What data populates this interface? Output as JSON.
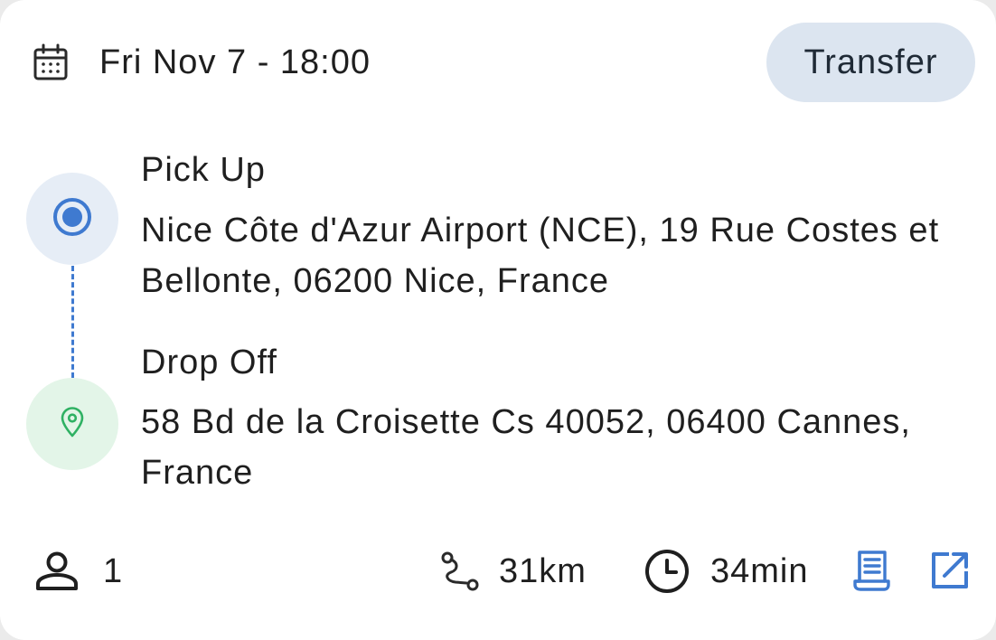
{
  "header": {
    "date_icon": "calendar-icon",
    "datetime": "Fri Nov 7 - 18:00",
    "type_badge": "Transfer"
  },
  "route": {
    "pickup": {
      "icon": "pickup-target-icon",
      "label": "Pick Up",
      "address": "Nice Côte d'Azur Airport (NCE), 19 Rue Costes et Bellonte, 06200 Nice, France",
      "accent_color": "#3f7ad0"
    },
    "dropoff": {
      "icon": "location-pin-icon",
      "label": "Drop Off",
      "address": "58 Bd de la Croisette Cs 40052, 06400 Cannes, France",
      "accent_color": "#2fb163"
    }
  },
  "footer": {
    "passengers": {
      "icon": "person-icon",
      "value": "1"
    },
    "distance": {
      "icon": "route-icon",
      "value": "31km"
    },
    "duration": {
      "icon": "clock-icon",
      "value": "34min"
    },
    "actions": [
      {
        "icon": "receipt-icon",
        "color": "#3f7ad0"
      },
      {
        "icon": "open-external-icon",
        "color": "#3f7ad0"
      }
    ]
  }
}
